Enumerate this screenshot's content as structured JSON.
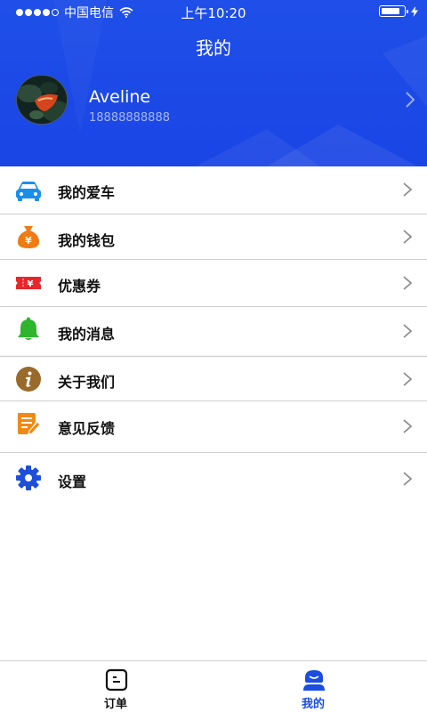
{
  "status_bar": {
    "carrier": "中国电信",
    "time": "上午10:20",
    "signal_dots": 5,
    "signal_filled": 4
  },
  "header": {
    "title": "我的",
    "background_color": "#1a46e6"
  },
  "profile": {
    "name": "Aveline",
    "phone": "18888888888"
  },
  "menu": {
    "items": [
      {
        "label": "我的爱车",
        "icon": "car-icon",
        "color": "#1a8fe8"
      },
      {
        "label": "我的钱包",
        "icon": "money-bag-icon",
        "color": "#f07b13"
      },
      {
        "label": "优惠券",
        "icon": "coupon-icon",
        "color": "#e8262c"
      },
      {
        "label": "我的消息",
        "icon": "bell-icon",
        "color": "#2db52d"
      },
      {
        "label": "关于我们",
        "icon": "info-icon",
        "color": "#9a6a2a"
      },
      {
        "label": "意见反馈",
        "icon": "feedback-icon",
        "color": "#f08a17"
      },
      {
        "label": "设置",
        "icon": "gear-icon",
        "color": "#1d4fd8"
      }
    ]
  },
  "tabbar": {
    "tabs": [
      {
        "label": "订单",
        "icon": "order-icon",
        "active": false,
        "color": "#111111"
      },
      {
        "label": "我的",
        "icon": "profile-icon",
        "active": true,
        "color": "#1a4de0"
      }
    ]
  }
}
